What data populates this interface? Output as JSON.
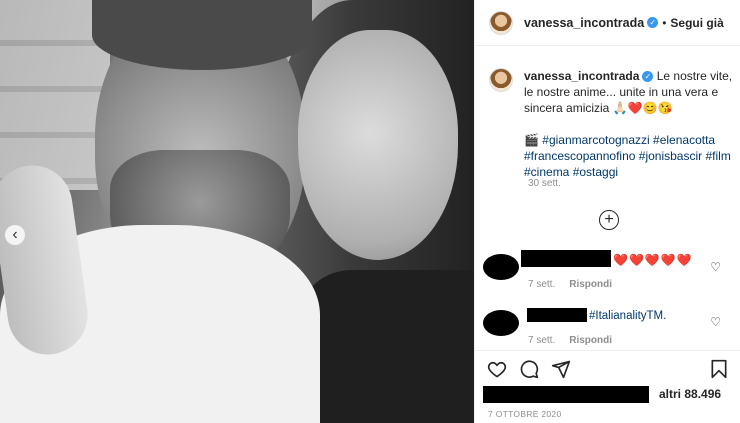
{
  "header": {
    "username": "vanessa_incontrada",
    "separator": "•",
    "follow_label": "Segui già"
  },
  "caption": {
    "username": "vanessa_incontrada",
    "text": "Le nostre vite, le nostre anime... unite in una vera e sincera amicizia 🙏🏻❤️😊😘",
    "film_emoji": "🎬",
    "hashtags": [
      "#gianmarcotognazzi",
      "#elenacotta",
      "#francescopannofino",
      "#jonisbascir",
      "#film",
      "#cinema",
      "#ostaggi"
    ],
    "time": "30 sett."
  },
  "comments": [
    {
      "text": "❤️❤️❤️❤️❤️",
      "time": "7 sett.",
      "reply_label": "Rispondi"
    },
    {
      "text": "#ItalianalityTM.",
      "time": "7 sett.",
      "reply_label": "Rispondi"
    }
  ],
  "likes": {
    "text": "altri 88.496"
  },
  "post_date": "7 OTTOBRE 2020",
  "icons": {
    "plus": "+",
    "prev": "‹",
    "verified": "✓"
  },
  "colors": {
    "link": "#00376b",
    "verified": "#3897f0",
    "heart": "#ed4956",
    "meta": "#8e8e8e"
  }
}
